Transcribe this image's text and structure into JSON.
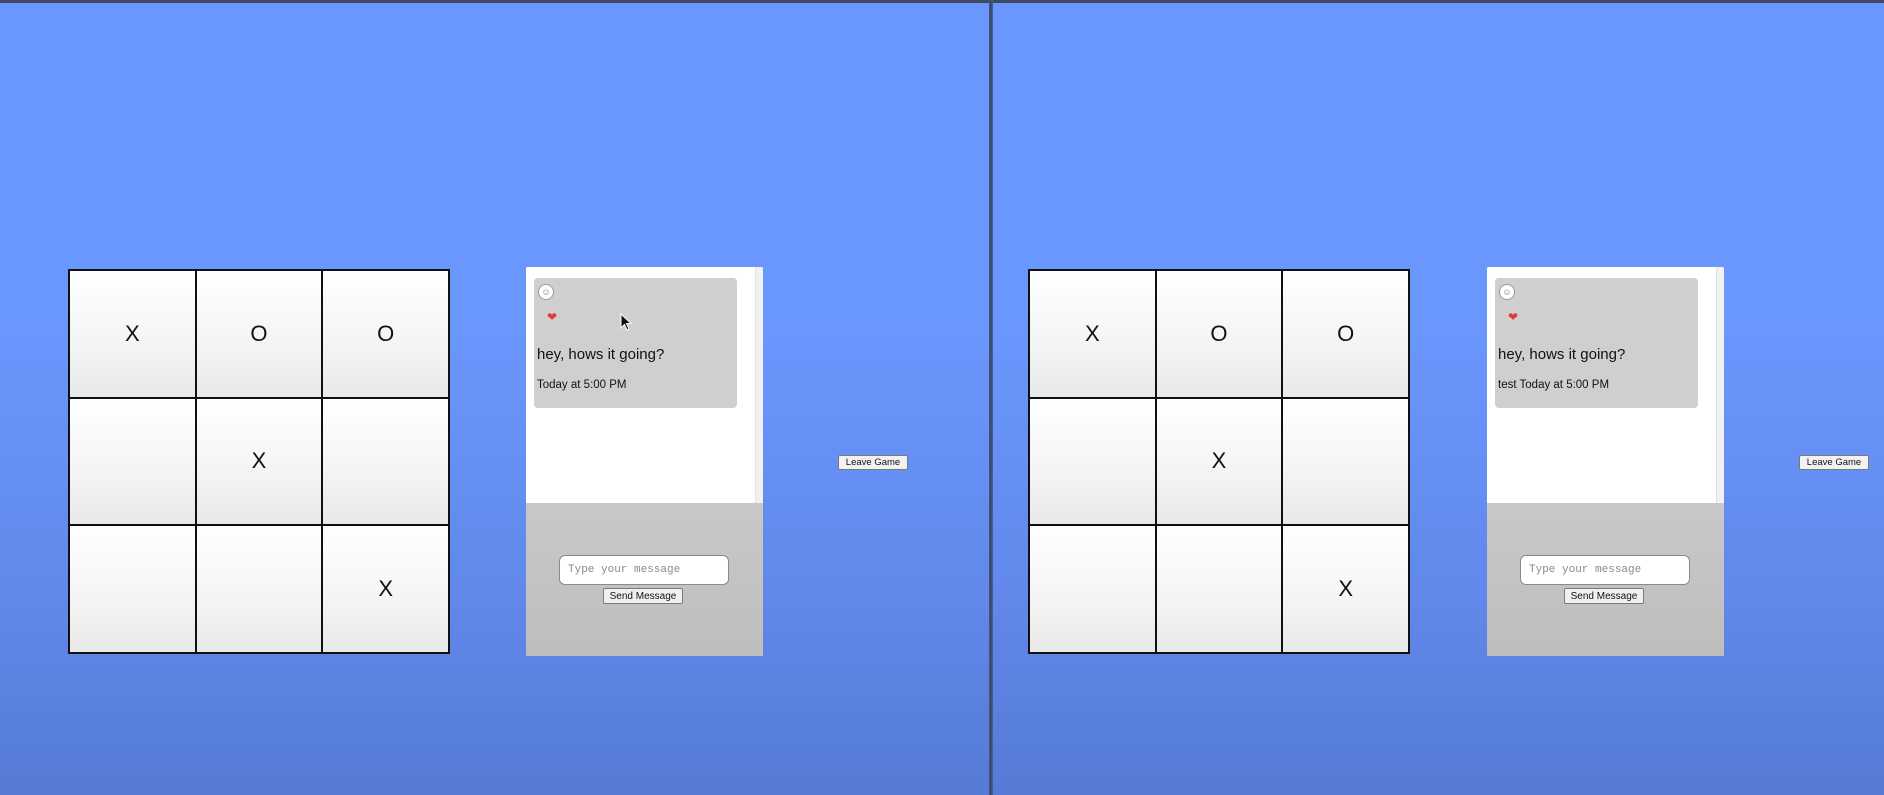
{
  "panes": [
    {
      "board": {
        "cells": [
          "X",
          "O",
          "O",
          "",
          "X",
          "",
          "",
          "",
          "X"
        ]
      },
      "chat": {
        "reaction_icon": "smiley-icon",
        "reaction_emoji": "☺",
        "heart_icon": "heart-icon",
        "heart_glyph": "❤",
        "message_text": "hey, hows it going?",
        "message_meta": "Today at 5:00 PM",
        "input_placeholder": "Type your message",
        "input_value": "",
        "send_label": "Send Message"
      },
      "leave_label": "Leave Game"
    },
    {
      "board": {
        "cells": [
          "X",
          "O",
          "O",
          "",
          "X",
          "",
          "",
          "",
          "X"
        ]
      },
      "chat": {
        "reaction_icon": "smiley-icon",
        "reaction_emoji": "☺",
        "heart_icon": "heart-icon",
        "heart_glyph": "❤",
        "message_text": "hey, hows it going?",
        "message_meta": "test Today at 5:00 PM",
        "input_placeholder": "Type your message",
        "input_value": "",
        "send_label": "Send Message"
      },
      "leave_label": "Leave Game"
    }
  ],
  "colors": {
    "background": "#6a97fe",
    "board_line": "#111111",
    "message_bubble": "#cfcfcf",
    "composer": "#c4c4c4",
    "heart": "#e23b3b"
  }
}
